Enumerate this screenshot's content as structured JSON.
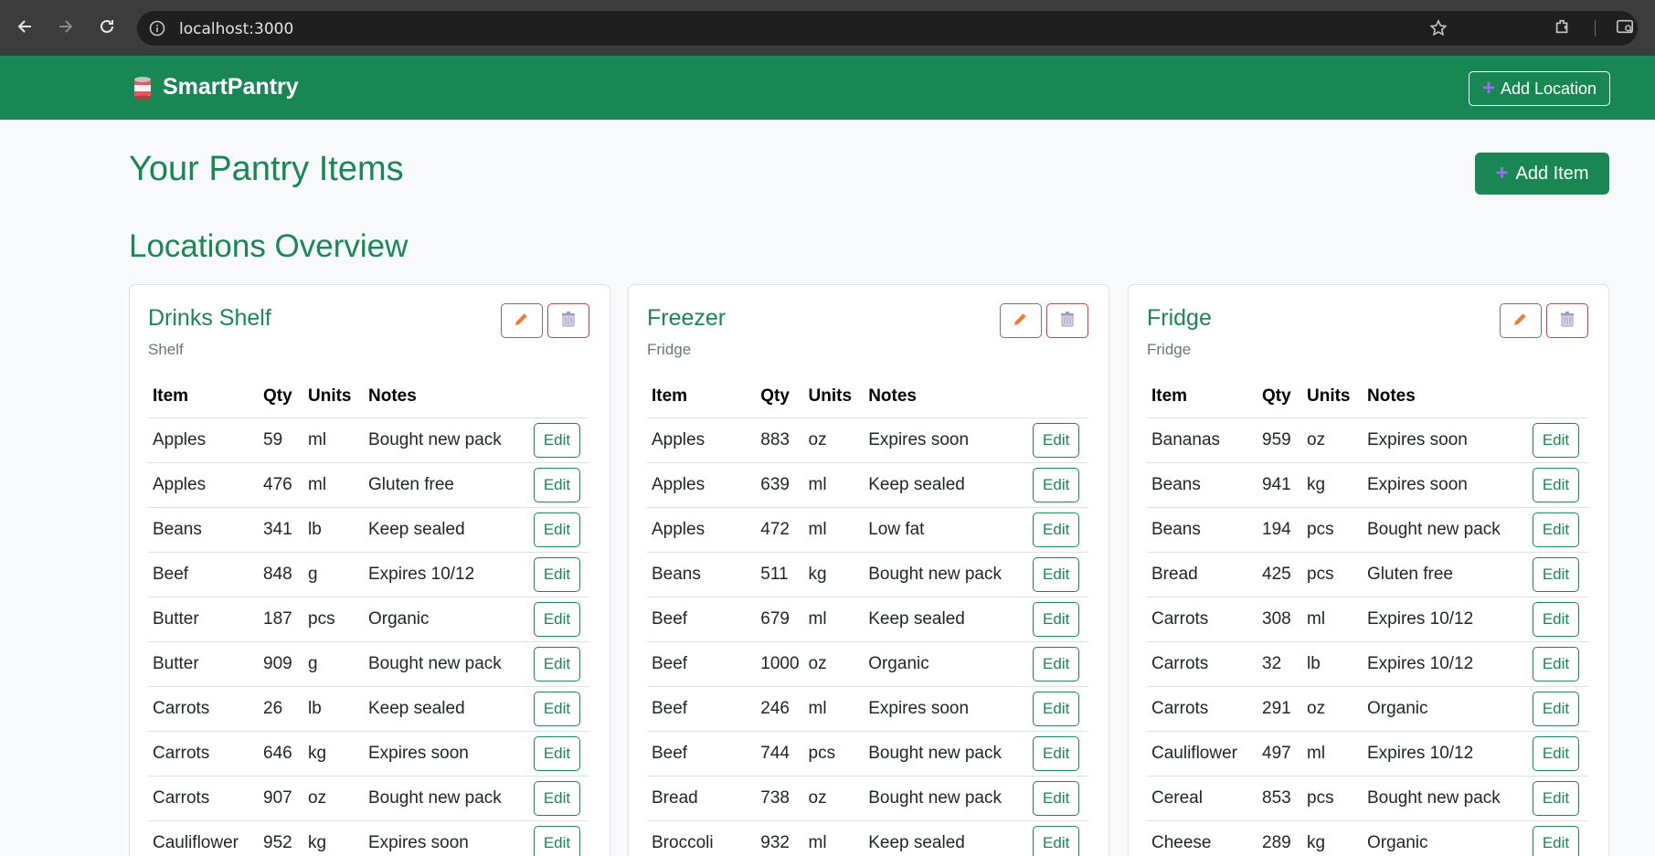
{
  "browser": {
    "url": "localhost:3000"
  },
  "navbar": {
    "brand": "SmartPantry",
    "add_location_label": "Add Location"
  },
  "main": {
    "title": "Your Pantry Items",
    "add_item_label": "Add Item",
    "section_title": "Locations Overview"
  },
  "columns": [
    "Item",
    "Qty",
    "Units",
    "Notes"
  ],
  "edit_label": "Edit",
  "colors": {
    "brand": "#198754",
    "danger": "#dc3545",
    "pencil": "#f07a3b",
    "plus": "#9b6cf5"
  },
  "locations": [
    {
      "name": "Drinks Shelf",
      "type": "Shelf",
      "items": [
        [
          "Apples",
          "59",
          "ml",
          "Bought new pack"
        ],
        [
          "Apples",
          "476",
          "ml",
          "Gluten free"
        ],
        [
          "Beans",
          "341",
          "lb",
          "Keep sealed"
        ],
        [
          "Beef",
          "848",
          "g",
          "Expires 10/12"
        ],
        [
          "Butter",
          "187",
          "pcs",
          "Organic"
        ],
        [
          "Butter",
          "909",
          "g",
          "Bought new pack"
        ],
        [
          "Carrots",
          "26",
          "lb",
          "Keep sealed"
        ],
        [
          "Carrots",
          "646",
          "kg",
          "Expires soon"
        ],
        [
          "Carrots",
          "907",
          "oz",
          "Bought new pack"
        ],
        [
          "Cauliflower",
          "952",
          "kg",
          "Expires soon"
        ]
      ]
    },
    {
      "name": "Freezer",
      "type": "Fridge",
      "items": [
        [
          "Apples",
          "883",
          "oz",
          "Expires soon"
        ],
        [
          "Apples",
          "639",
          "ml",
          "Keep sealed"
        ],
        [
          "Apples",
          "472",
          "ml",
          "Low fat"
        ],
        [
          "Beans",
          "511",
          "kg",
          "Bought new pack"
        ],
        [
          "Beef",
          "679",
          "ml",
          "Keep sealed"
        ],
        [
          "Beef",
          "1000",
          "oz",
          "Organic"
        ],
        [
          "Beef",
          "246",
          "ml",
          "Expires soon"
        ],
        [
          "Beef",
          "744",
          "pcs",
          "Bought new pack"
        ],
        [
          "Bread",
          "738",
          "oz",
          "Bought new pack"
        ],
        [
          "Broccoli",
          "932",
          "ml",
          "Keep sealed"
        ]
      ]
    },
    {
      "name": "Fridge",
      "type": "Fridge",
      "items": [
        [
          "Bananas",
          "959",
          "oz",
          "Expires soon"
        ],
        [
          "Beans",
          "941",
          "kg",
          "Expires soon"
        ],
        [
          "Beans",
          "194",
          "pcs",
          "Bought new pack"
        ],
        [
          "Bread",
          "425",
          "pcs",
          "Gluten free"
        ],
        [
          "Carrots",
          "308",
          "ml",
          "Expires 10/12"
        ],
        [
          "Carrots",
          "32",
          "lb",
          "Expires 10/12"
        ],
        [
          "Carrots",
          "291",
          "oz",
          "Organic"
        ],
        [
          "Cauliflower",
          "497",
          "ml",
          "Expires 10/12"
        ],
        [
          "Cereal",
          "853",
          "pcs",
          "Bought new pack"
        ],
        [
          "Cheese",
          "289",
          "kg",
          "Organic"
        ]
      ]
    }
  ]
}
